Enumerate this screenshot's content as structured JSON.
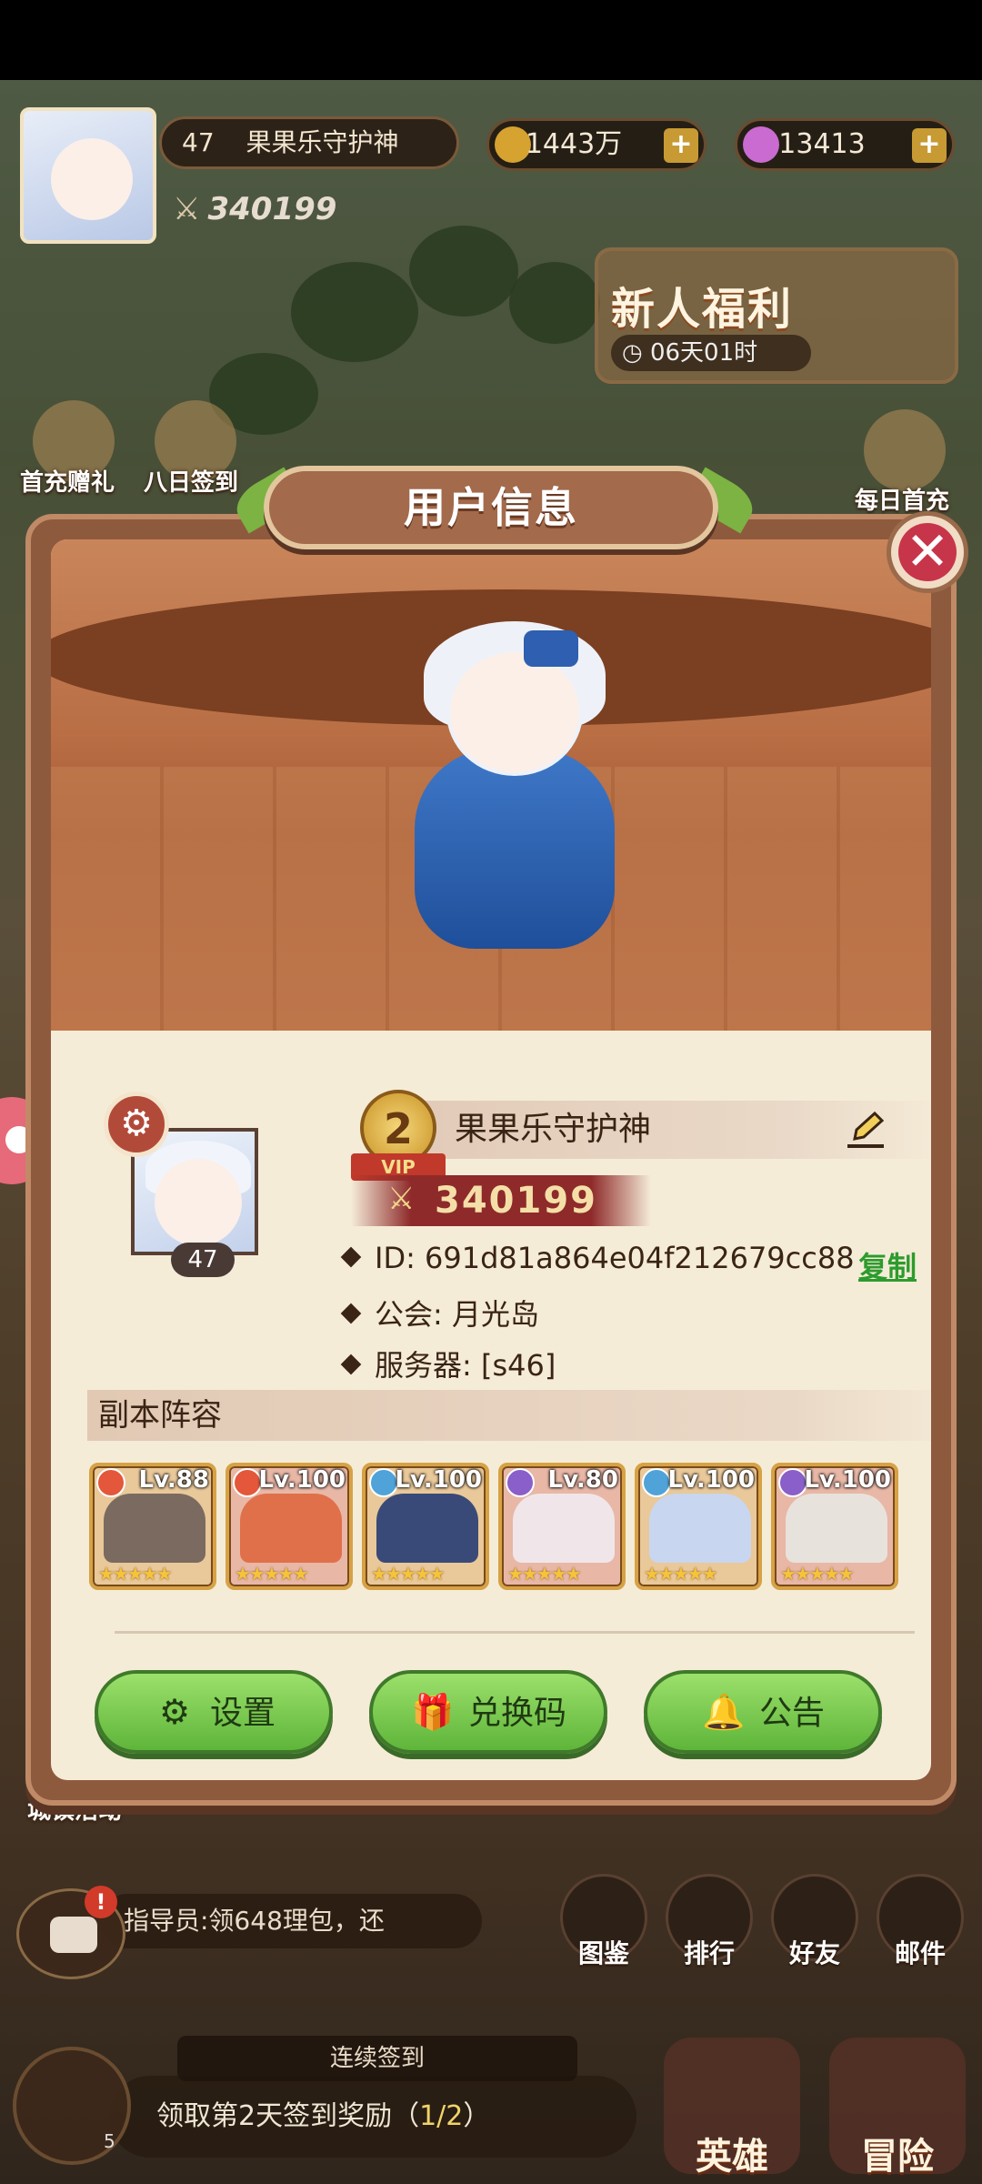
{
  "hud": {
    "level": "47",
    "player_name": "果果乐守护神",
    "power": "340199",
    "gold": "1443万",
    "gems": "13413",
    "newbie_title": "新人福利",
    "newbie_timer": "06天01时",
    "first_charge": "首充赠礼",
    "eight_day": "八日签到",
    "daily_charge": "每日首充",
    "town_event": "城镇活动"
  },
  "dialog": {
    "title": "用户信息",
    "close_label": "✕",
    "vip_level": "2",
    "vip_label": "VIP",
    "name": "果果乐守护神",
    "power": "340199",
    "avatar_level": "47",
    "id_line": "ID: 691d81a864e04f212679cc88",
    "copy_label": "复制",
    "guild_line": "公会: 月光岛",
    "server_line": "服务器: [s46]",
    "lineup_title": "副本阵容",
    "heroes": [
      {
        "level": "Lv.88",
        "element": "fire",
        "color": "#7a6a60",
        "stars": "★★★★★"
      },
      {
        "level": "Lv.100",
        "element": "fire",
        "color": "#e0704a",
        "stars": "★★★★★"
      },
      {
        "level": "Lv.100",
        "element": "water",
        "color": "#3a4a78",
        "stars": "★★★★★"
      },
      {
        "level": "Lv.80",
        "element": "dark",
        "color": "#f0e6ea",
        "stars": "★★★★★"
      },
      {
        "level": "Lv.100",
        "element": "water",
        "color": "#c8d6f0",
        "stars": "★★★★★"
      },
      {
        "level": "Lv.100",
        "element": "dark",
        "color": "#e8e2dc",
        "stars": "★★★★★"
      }
    ],
    "buttons": {
      "settings": "设置",
      "redeem": "兑换码",
      "notice": "公告"
    }
  },
  "bottom": {
    "chat_badge": "!",
    "chat_text": "指导员:领648理包，还",
    "nav": [
      "图鉴",
      "排行",
      "好友",
      "邮件"
    ],
    "signin_title": "连续签到",
    "signin_text": "领取第2天签到奖励（",
    "signin_count": "1/2",
    "signin_close": "）",
    "sign_badge": "5",
    "hero_btn": "英雄",
    "adventure_btn": "冒险"
  },
  "colors": {
    "button_green": "#6fc447",
    "close_red": "#c7354a",
    "link_green": "#2d9b2d",
    "vip_red": "#c0392b"
  }
}
